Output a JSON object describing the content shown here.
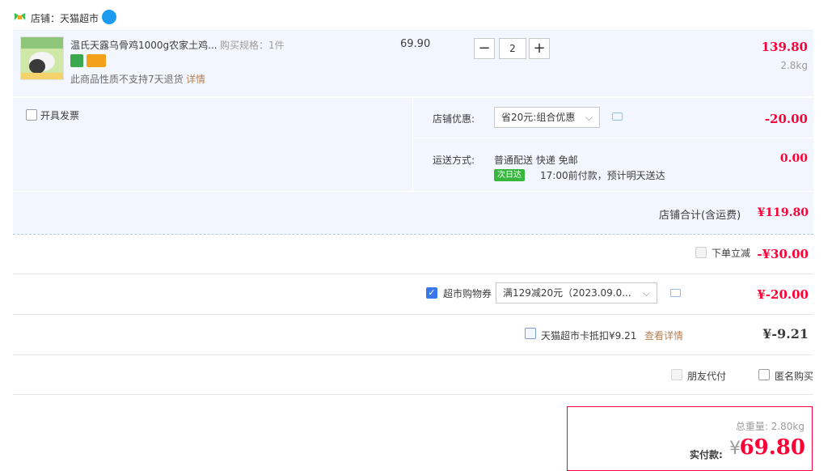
{
  "shop": {
    "label": "店铺：天猫超市"
  },
  "item": {
    "title": "温氏天露乌骨鸡1000g农家土鸡...",
    "spec": "购买规格：1件",
    "note": "此商品性质不支持7天退货",
    "note_link": "详情",
    "unit_price": "69.90",
    "quantity": "2",
    "qty_minus": "−",
    "qty_plus": "+",
    "subtotal": "139.80",
    "weight": "2.8kg"
  },
  "options": {
    "invoice_label": "开具发票",
    "shop_discount_label": "店铺优惠:",
    "shop_discount_value": "省20元:组合优惠",
    "shop_discount_amount": "-20.00",
    "shipping_label": "运送方式:",
    "shipping_line1": "普通配送 快递 免邮",
    "shipping_tag": "次日达",
    "shipping_line2": "17:00前付款，预计明天送达",
    "shipping_amount": "0.00",
    "shop_total_label": "店铺合计(含运费)",
    "shop_total_amount": "¥119.80"
  },
  "discounts": {
    "instant_label": "下单立减",
    "instant_amount": "-¥30.00",
    "coupon_check": "✓",
    "coupon_label": "超市购物券",
    "coupon_value": "满129减20元（2023.09.0...",
    "coupon_amount": "¥-20.00",
    "card_label": "天猫超市卡抵扣¥9.21",
    "card_link": "查看详情",
    "card_amount": "¥-9.21",
    "friend_pay_label": "朋友代付",
    "anonymous_label": "匿名购买"
  },
  "summary": {
    "total_weight": "总重量: 2.80kg",
    "pay_label": "实付款:",
    "currency": "¥",
    "pay_amount": "69.80"
  },
  "colors": {
    "accent_red": "#ff0036",
    "row_bg": "#f2f7ff",
    "link_brown": "#b47f54",
    "checkbox_blue": "#3a78ea"
  }
}
